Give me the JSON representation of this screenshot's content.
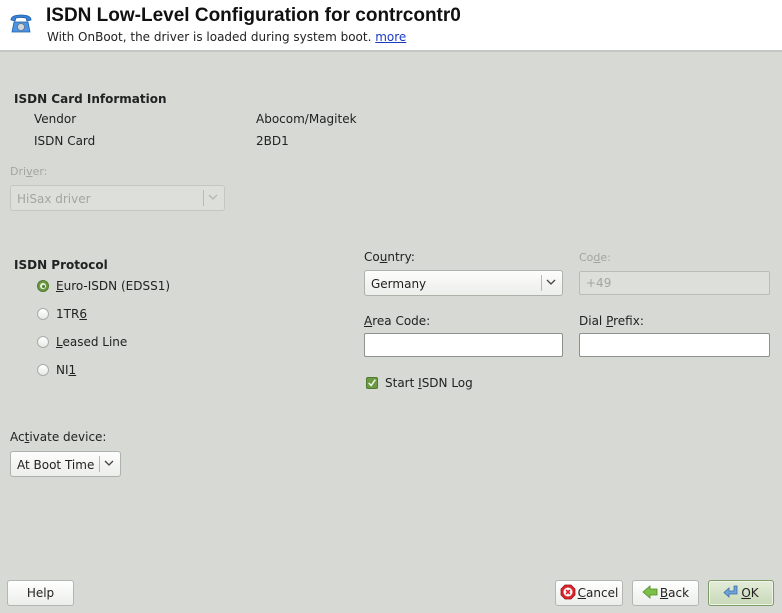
{
  "header": {
    "icon": "telephone-icon",
    "title": "ISDN Low-Level Configuration for contrcontr0",
    "subtitle": "With OnBoot, the driver is loaded during system boot.",
    "more_link": "more"
  },
  "card_info": {
    "heading": "ISDN Card Information",
    "rows": [
      {
        "label": "Vendor",
        "value": "Abocom/Magitek"
      },
      {
        "label": "ISDN Card",
        "value": "2BD1"
      }
    ]
  },
  "driver": {
    "label_pre": "Dri",
    "label_mnemonic": "v",
    "label_post": "er:",
    "value": "HiSax driver",
    "disabled": true
  },
  "protocol": {
    "heading": "ISDN Protocol",
    "options": [
      {
        "pre": "",
        "mn": "E",
        "post": "uro-ISDN (EDSS1)",
        "selected": true
      },
      {
        "pre": "1TR",
        "mn": "6",
        "post": "",
        "selected": false
      },
      {
        "pre": "",
        "mn": "L",
        "post": "eased Line",
        "selected": false
      },
      {
        "pre": "NI",
        "mn": "1",
        "post": "",
        "selected": false
      }
    ]
  },
  "country": {
    "label_pre": "Co",
    "label_mnemonic": "u",
    "label_post": "ntry:",
    "value": "Germany"
  },
  "code": {
    "label_pre": "Co",
    "label_mnemonic": "d",
    "label_post": "e:",
    "value": "+49",
    "disabled": true
  },
  "area_code": {
    "label_pre": "",
    "label_mnemonic": "A",
    "label_post": "rea Code:",
    "value": ""
  },
  "dial_prefix": {
    "label_pre": "Dial ",
    "label_mnemonic": "P",
    "label_post": "refix:",
    "value": ""
  },
  "isdn_log": {
    "label_pre": "Start ",
    "label_mnemonic": "I",
    "label_post": "SDN Log",
    "checked": true
  },
  "activate": {
    "label_pre": "Ac",
    "label_mnemonic": "t",
    "label_post": "ivate device:",
    "value": "At Boot Time"
  },
  "buttons": {
    "help": "Help",
    "cancel_mn": "C",
    "cancel_rest": "ancel",
    "back_mn": "B",
    "back_rest": "ack",
    "ok_mn": "O",
    "ok_rest": "K"
  },
  "colors": {
    "accent_green": "#6b9a42",
    "link_blue": "#1a3cc4",
    "background": "#d6d9d4"
  }
}
